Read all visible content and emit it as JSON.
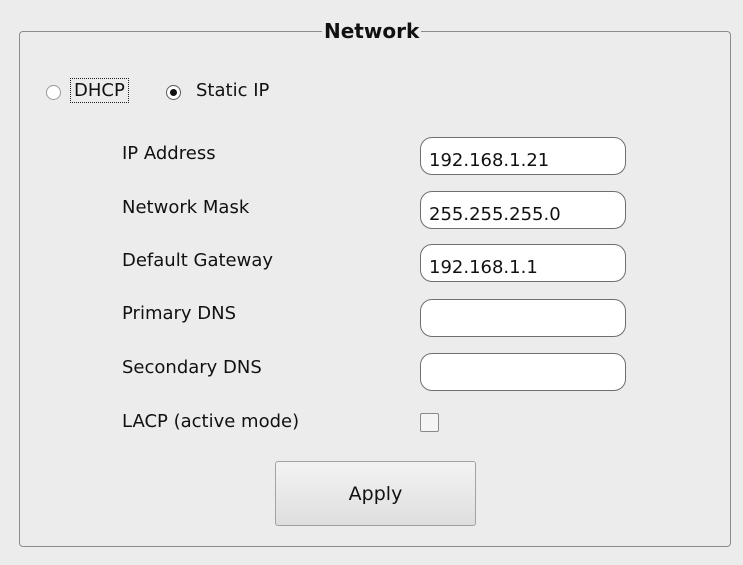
{
  "network_panel": {
    "title": "Network",
    "mode": {
      "dhcp_label": "DHCP",
      "static_label": "Static IP",
      "selected": "Static IP"
    },
    "fields": {
      "ip_address": {
        "label": "IP Address",
        "value": "192.168.1.21"
      },
      "network_mask": {
        "label": "Network Mask",
        "value": "255.255.255.0"
      },
      "default_gateway": {
        "label": "Default Gateway",
        "value": "192.168.1.1"
      },
      "primary_dns": {
        "label": "Primary DNS",
        "value": ""
      },
      "secondary_dns": {
        "label": "Secondary DNS",
        "value": ""
      }
    },
    "lacp": {
      "label": "LACP (active mode)",
      "checked": false
    },
    "apply_label": "Apply"
  }
}
